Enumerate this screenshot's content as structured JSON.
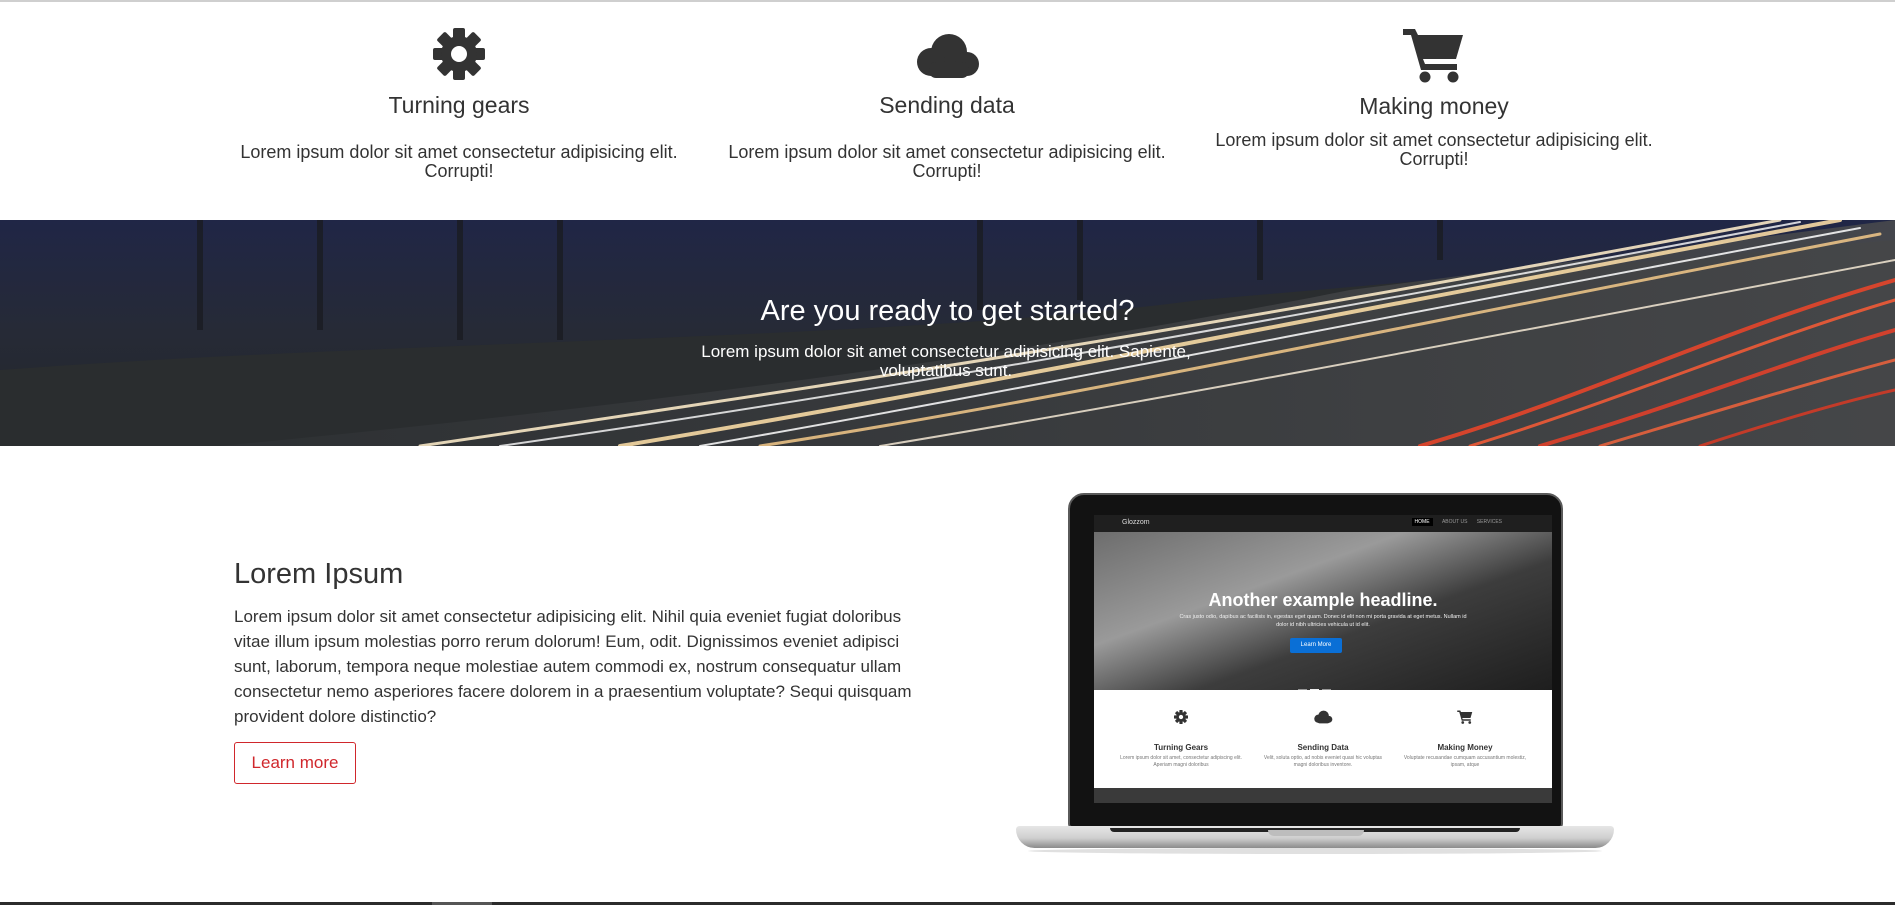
{
  "features": [
    {
      "icon": "gear-icon",
      "title": "Turning gears",
      "text": "Lorem ipsum dolor sit amet consectetur adipisicing elit. Corrupti!"
    },
    {
      "icon": "cloud-icon",
      "title": "Sending data",
      "text": "Lorem ipsum dolor sit amet consectetur adipisicing elit. Corrupti!"
    },
    {
      "icon": "shopping-cart-icon",
      "title": "Making money",
      "text": "Lorem ipsum dolor sit amet consectetur adipisicing elit. Corrupti!"
    }
  ],
  "banner": {
    "title": "Are you ready to get started?",
    "text": "Lorem ipsum dolor sit amet consectetur adipisicing elit. Sapiente, voluptatibus sunt."
  },
  "about": {
    "title": "Lorem Ipsum",
    "text": "Lorem ipsum dolor sit amet consectetur adipisicing elit. Nihil quia eveniet fugiat doloribus vitae illum ipsum molestias porro rerum dolorum! Eum, odit. Dignissimos eveniet adipisci sunt, laborum, tempora neque molestiae autem commodi ex, nostrum consequatur ullam consectetur nemo asperiores facere dolorem in a praesentium voluptate? Sequi quisquam provident dolore distinctio?",
    "button_label": "Learn more"
  },
  "laptop_screen": {
    "brand": "Glozzom",
    "menu": [
      "HOME",
      "ABOUT US",
      "SERVICES"
    ],
    "headline": "Another example headline.",
    "subtext": "Cras justo odio, dapibus ac facilisis in, egestas eget quam. Donec id elit non mi porta gravida at eget metus. Nullam id dolor id nibh ultricies vehicula ut id elit.",
    "button": "Learn More",
    "features": [
      {
        "title": "Turning Gears",
        "text": "Lorem ipsum dolor sit amet, consectetur adipiscing elit. Aperiam magni doloribus"
      },
      {
        "title": "Sending Data",
        "text": "Velit, soluta optio, ad nobis eveniet quasi hic voluptas magni doloribus inventore."
      },
      {
        "title": "Making Money",
        "text": "Voluptate recusandae cumquam accusantium molestiz, ipsam, atque"
      }
    ]
  },
  "colors": {
    "accent": "#d0272c",
    "text": "#333333",
    "screen_button": "#0a6fd6"
  }
}
